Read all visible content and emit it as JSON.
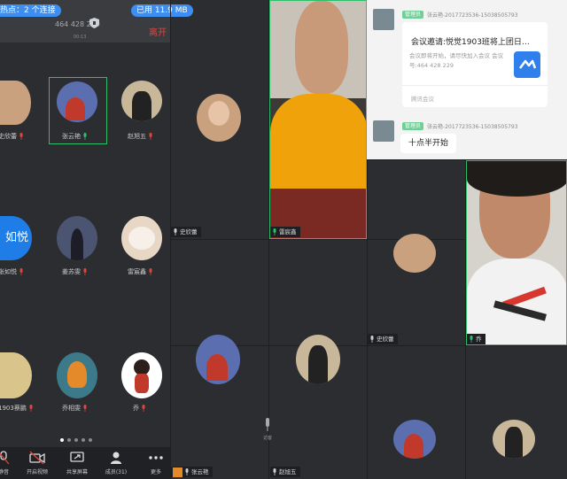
{
  "status": {
    "hotspot": "热点：2 个连接",
    "data_used": "已用 11.9 MB"
  },
  "meeting": {
    "id": "464 428 229",
    "subinfo": "00:13",
    "leave_label": "离开"
  },
  "participants": [
    {
      "name": "史欣蕾",
      "color": "#c9a17f"
    },
    {
      "name": "张云艳",
      "color": "#5b6fb0"
    },
    {
      "name": "赵旭五",
      "color": "#c9b79a"
    },
    {
      "name": "张如悦",
      "color": "#1e7de6",
      "avatar_text": "如悦"
    },
    {
      "name": "姜苏雯",
      "color": "#4b5470"
    },
    {
      "name": "雷宸鑫",
      "color": "#e8d7c5"
    },
    {
      "name": "1903蔡鹏",
      "color": "#d9c48c"
    },
    {
      "name": "乔相雯",
      "color": "#3c7a8a"
    },
    {
      "name": "乔",
      "color": "#ffffff"
    }
  ],
  "pager": {
    "count": 5,
    "active": 0
  },
  "toolbar": [
    {
      "label": "静音",
      "icon": "mic-off-icon"
    },
    {
      "label": "开启视频",
      "icon": "video-off-icon"
    },
    {
      "label": "共享屏幕",
      "icon": "share-screen-icon"
    },
    {
      "label": "成员(31)",
      "icon": "members-icon"
    },
    {
      "label": "更多",
      "icon": "more-icon"
    }
  ],
  "tiles": {
    "shixinlei_label": "史欣蕾",
    "video1_label": "雷宸鑫",
    "tile_shi_label": "史欣蕾",
    "video2_label": "乔",
    "speaking_label": "张云艳",
    "tile_zhao_label": "赵旭五",
    "small_text": "访客"
  },
  "chat": {
    "tag": "管理员",
    "sender": "张云艳-2017723536-15038505793",
    "card_title": "会议邀请:悦觉1903班将上团日…",
    "card_desc": "会议即将开始，请尽快加入会议 会议号:464 428 229",
    "card_footer": "腾讯会议",
    "bubble_tag": "管理员",
    "bubble_sender": "张云艳-2017723536-15038505793",
    "bubble_text": "十点半开始"
  },
  "colors": {
    "accent": "#3d8ef0",
    "active_border": "#2fbf6b",
    "danger": "#e0463c",
    "mic_on": "#2fbf6b",
    "mic_off": "#e0463c"
  }
}
